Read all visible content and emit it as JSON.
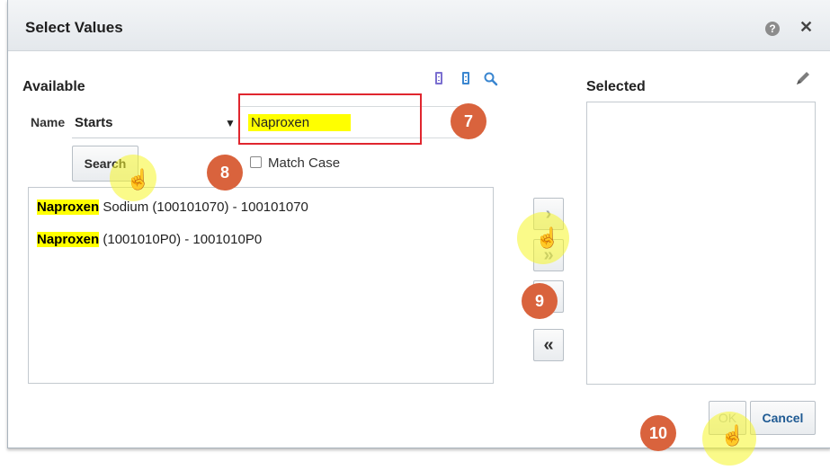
{
  "dialog": {
    "title": "Select Values",
    "help_icon": "question-circle-icon",
    "close_icon": "close-icon"
  },
  "available": {
    "heading": "Available",
    "name_label": "Name",
    "operator": "Starts",
    "search_value": "Naproxen",
    "search_button": "Search",
    "match_case_label": "Match Case",
    "match_case_checked": false,
    "results": [
      {
        "match": "Naproxen",
        "rest": " Sodium (100101070) - 100101070"
      },
      {
        "match": "Naproxen",
        "rest": " (1001010P0) - 1001010P0"
      }
    ]
  },
  "shuttle": {
    "move": "›",
    "move_all": "»",
    "remove": "‹",
    "remove_all": "«"
  },
  "selected": {
    "heading": "Selected",
    "edit_icon": "pencil-icon"
  },
  "footer": {
    "ok": "OK",
    "cancel": "Cancel"
  },
  "annotations": {
    "step7": "7",
    "step8": "8",
    "step9": "9",
    "step10": "10"
  },
  "colors": {
    "highlight": "#ffff00",
    "callout": "#d9633d",
    "red_box": "#e0262e",
    "icon_blue": "#3a86d0"
  }
}
